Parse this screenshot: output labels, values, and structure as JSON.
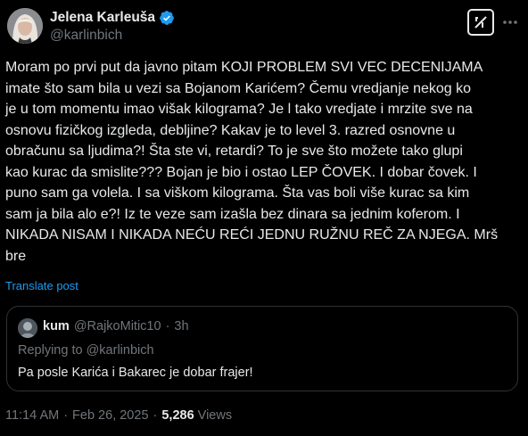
{
  "author": {
    "display_name": "Jelena Karleuša",
    "handle": "@karlinbich",
    "verified": true,
    "verified_color": "#1d9bf0"
  },
  "actions": {
    "grok_icon": "grok-icon",
    "more_icon": "more-horizontal-icon"
  },
  "tweet": {
    "text": "Moram po prvi put da javno pitam KOJI PROBLEM SVI VEC DECENIJAMA\nimate što sam bila u vezi sa Bojanom Karićem? Čemu vredjanje nekog ko\nje u tom momentu imao višak kilograma? Je l tako vredjate i mrzite sve na\nosnovu fizičkog izgleda, debljine? Kakav je to level 3. razred osnovne u\nobračunu sa ljudima?! Šta ste vi, retardi? To je sve što možete tako glupi\nkao kurac da smislite??? Bojan je bio i ostao LEP ČOVEK. I dobar čovek. I\npuno sam ga volela. I sa viškom kilograma. Šta vas boli više kurac sa kim\nsam ja bila alo e?! Iz te veze sam izašla bez dinara sa jednim koferom. I\nNIKADA NISAM I NIKADA NEĆU REĆI JEDNU RUŽNU REČ ZA NJEGA. Mrš\nbre",
    "translate_label": "Translate post"
  },
  "quote": {
    "name": "kum",
    "handle": "@RajkoMitic10",
    "separator": "·",
    "time": "3h",
    "replying_prefix": "Replying to ",
    "replying_handle": "@karlinbich",
    "text": "Pa posle Karića i Bakarec je dobar frajer!"
  },
  "meta": {
    "time": "11:14 AM",
    "dot1": "·",
    "date": "Feb 26, 2025",
    "dot2": "·",
    "views_count": "5,286",
    "views_label": "Views"
  },
  "colors": {
    "background": "#000000",
    "text": "#e7e9ea",
    "muted": "#71767b",
    "accent": "#1d9bf0",
    "border": "#2f3336"
  }
}
